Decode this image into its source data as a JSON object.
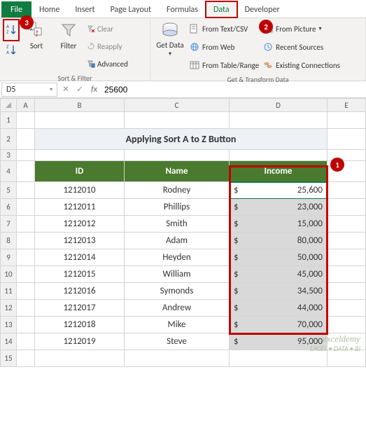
{
  "tabs": {
    "file": "File",
    "home": "Home",
    "insert": "Insert",
    "pagelayout": "Page Layout",
    "formulas": "Formulas",
    "data": "Data",
    "developer": "Developer"
  },
  "ribbon": {
    "sortFilterGroup": "Sort & Filter",
    "getGroup": "Get & Transform Data",
    "sortAZ": "A→Z",
    "sortZA": "Z→A",
    "sort": "Sort",
    "filter": "Filter",
    "clear": "Clear",
    "reapply": "Reapply",
    "advanced": "Advanced",
    "getData": "Get Data",
    "fromCsv": "From Text/CSV",
    "fromWeb": "From Web",
    "fromTable": "From Table/Range",
    "fromPicture": "From Picture",
    "recentSources": "Recent Sources",
    "existingConn": "Existing Connections"
  },
  "callouts": {
    "c1": "1",
    "c2": "2",
    "c3": "3"
  },
  "namebox": "D5",
  "formula": "25600",
  "cols": {
    "A": "A",
    "B": "B",
    "C": "C",
    "D": "D",
    "E": "E"
  },
  "title": "Applying Sort A to Z Button",
  "headers": {
    "id": "ID",
    "name": "Name",
    "income": "Income"
  },
  "rows": [
    {
      "n": "1"
    },
    {
      "n": "2"
    },
    {
      "n": "3"
    },
    {
      "n": "4"
    },
    {
      "n": "5",
      "id": "1212010",
      "name": "Rodney",
      "cur": "$",
      "inc": "25,600"
    },
    {
      "n": "6",
      "id": "1212011",
      "name": "Phillips",
      "cur": "$",
      "inc": "23,000"
    },
    {
      "n": "7",
      "id": "1212012",
      "name": "Smith",
      "cur": "$",
      "inc": "15,000"
    },
    {
      "n": "8",
      "id": "1212013",
      "name": "Adam",
      "cur": "$",
      "inc": "80,000"
    },
    {
      "n": "9",
      "id": "1212014",
      "name": "Heyden",
      "cur": "$",
      "inc": "50,000"
    },
    {
      "n": "10",
      "id": "1212015",
      "name": "William",
      "cur": "$",
      "inc": "45,000"
    },
    {
      "n": "11",
      "id": "1212016",
      "name": "Symonds",
      "cur": "$",
      "inc": "34,500"
    },
    {
      "n": "12",
      "id": "1212017",
      "name": "Andrew",
      "cur": "$",
      "inc": "44,000"
    },
    {
      "n": "13",
      "id": "1212018",
      "name": "Mike",
      "cur": "$",
      "inc": "70,000"
    },
    {
      "n": "14",
      "id": "1212019",
      "name": "Steve",
      "cur": "$",
      "inc": "95,000"
    },
    {
      "n": "15"
    }
  ],
  "watermark": {
    "line1": "exceldemy",
    "line2": "EXCEL • DATA • BI"
  }
}
